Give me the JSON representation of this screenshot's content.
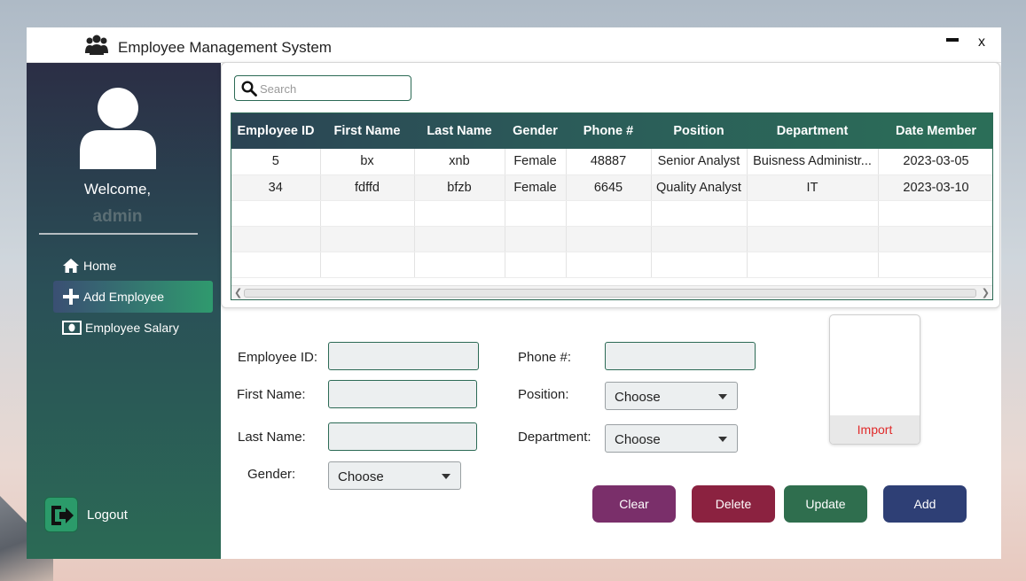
{
  "app": {
    "title": "Employee Management System",
    "close_label": "x"
  },
  "sidebar": {
    "welcome": "Welcome,",
    "username": "admin",
    "items": [
      {
        "label": "Home",
        "icon": "home-icon"
      },
      {
        "label": "Add Employee",
        "icon": "plus-icon",
        "active": true
      },
      {
        "label": "Employee Salary",
        "icon": "money-icon"
      }
    ],
    "logout": "Logout"
  },
  "search": {
    "placeholder": "Search"
  },
  "table": {
    "columns": [
      "Employee ID",
      "First Name",
      "Last Name",
      "Gender",
      "Phone #",
      "Position",
      "Department",
      "Date Member"
    ],
    "rows": [
      [
        "5",
        "bx",
        "xnb",
        "Female",
        "48887",
        "Senior Analyst",
        "Buisness Administr...",
        "2023-03-05"
      ],
      [
        "34",
        "fdffd",
        "bfzb",
        "Female",
        "6645",
        "Quality Analyst",
        "IT",
        "2023-03-10"
      ]
    ]
  },
  "form": {
    "employee_id_label": "Employee ID:",
    "first_name_label": "First Name:",
    "last_name_label": "Last Name:",
    "gender_label": "Gender:",
    "gender_value": "Choose",
    "phone_label": "Phone #:",
    "position_label": "Position:",
    "position_value": "Choose",
    "department_label": "Department:",
    "department_value": "Choose",
    "import_label": "Import"
  },
  "buttons": {
    "clear": "Clear",
    "delete": "Delete",
    "update": "Update",
    "add": "Add"
  },
  "colors": {
    "clear": "#7a2f6a",
    "delete": "#8b2240",
    "update": "#2f6e4e",
    "add": "#2e3f75",
    "accent": "#2c6a55"
  }
}
